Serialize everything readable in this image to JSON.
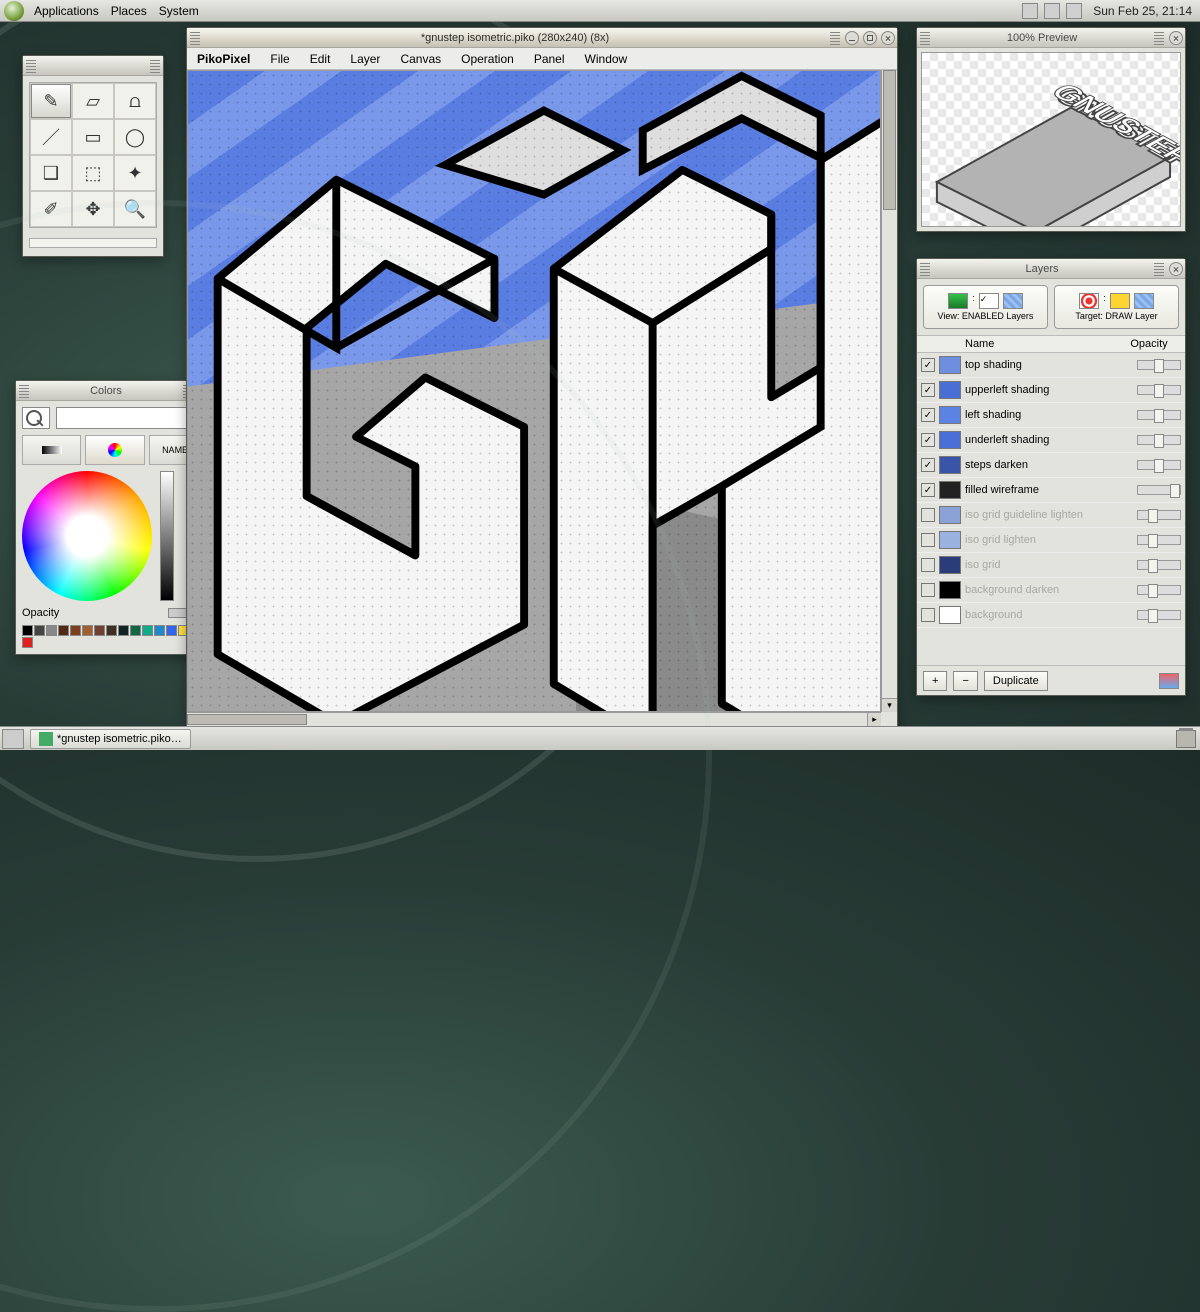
{
  "panel": {
    "menus": [
      "Applications",
      "Places",
      "System"
    ],
    "clock": "Sun Feb 25, 21:14"
  },
  "taskbar": {
    "task": "*gnustep isometric.piko…"
  },
  "toolbox": {
    "tools": [
      "pencil",
      "eraser",
      "fill",
      "line",
      "rect",
      "ellipse",
      "lasso",
      "select",
      "wand",
      "picker",
      "move",
      "zoom"
    ],
    "selected": "pencil"
  },
  "colors": {
    "title": "Colors",
    "named_label": "NAMED",
    "opacity_label": "Opacity",
    "swatches": [
      "#000",
      "#444",
      "#888",
      "#502a14",
      "#7a4020",
      "#a06030",
      "#704030",
      "#403020",
      "#122",
      "#164",
      "#1a8",
      "#28c",
      "#36e",
      "#ffe040",
      "#ff8030",
      "#e02020"
    ]
  },
  "canvas": {
    "title": "*gnustep isometric.piko (280x240) (8x)",
    "app": "PikoPixel",
    "menus": [
      "File",
      "Edit",
      "Layer",
      "Canvas",
      "Operation",
      "Panel",
      "Window"
    ]
  },
  "preview": {
    "title": "100% Preview",
    "caption": "GNUSTEP"
  },
  "layers": {
    "title": "Layers",
    "view_label": "View: ENABLED Layers",
    "target_label": "Target: DRAW Layer",
    "col_name": "Name",
    "col_opacity": "Opacity",
    "add": "+",
    "remove": "−",
    "dup": "Duplicate",
    "items": [
      {
        "name": "top shading",
        "enabled": true,
        "thumb": "#6e8fe0",
        "opacity": 0.5
      },
      {
        "name": "upperleft shading",
        "enabled": true,
        "thumb": "#496fd4",
        "opacity": 0.5
      },
      {
        "name": "left shading",
        "enabled": true,
        "thumb": "#5a83e4",
        "opacity": 0.5
      },
      {
        "name": "underleft shading",
        "enabled": true,
        "thumb": "#4a6fd6",
        "opacity": 0.5
      },
      {
        "name": "steps darken",
        "enabled": true,
        "thumb": "#3a55a8",
        "opacity": 0.5
      },
      {
        "name": "filled wireframe",
        "enabled": true,
        "thumb": "#222222",
        "opacity": 1.0
      },
      {
        "name": "iso grid guideline lighten",
        "enabled": false,
        "thumb": "#8aa2d6",
        "opacity": 0.3
      },
      {
        "name": "iso grid lighten",
        "enabled": false,
        "thumb": "#9ab2e0",
        "opacity": 0.3
      },
      {
        "name": "iso grid",
        "enabled": false,
        "thumb": "#2a3c7a",
        "opacity": 0.3
      },
      {
        "name": "background darken",
        "enabled": false,
        "thumb": "#000000",
        "opacity": 0.3
      },
      {
        "name": "background",
        "enabled": false,
        "thumb": "#ffffff",
        "opacity": 0.3
      }
    ]
  }
}
